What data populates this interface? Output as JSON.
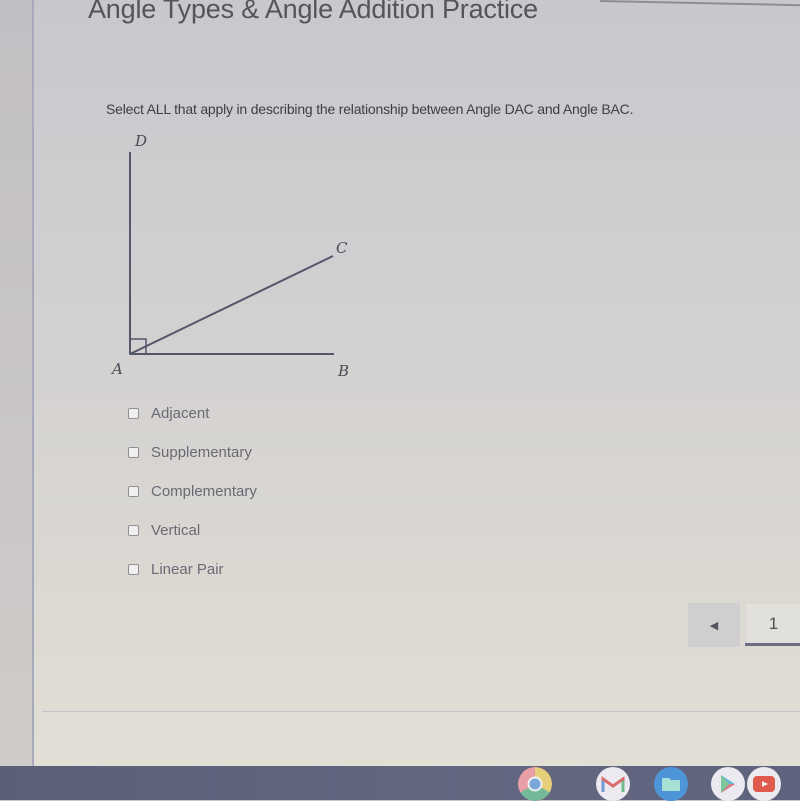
{
  "page": {
    "title": "Angle Types & Angle Addition Practice",
    "prompt": "Select ALL that apply in describing the relationship between Angle DAC and Angle BAC."
  },
  "figure": {
    "labels": {
      "D": "D",
      "C": "C",
      "A": "A",
      "B": "B"
    },
    "right_angle_marker_at": "A"
  },
  "options": [
    {
      "label": "Adjacent",
      "checked": false
    },
    {
      "label": "Supplementary",
      "checked": false
    },
    {
      "label": "Complementary",
      "checked": false
    },
    {
      "label": "Vertical",
      "checked": false
    },
    {
      "label": "Linear Pair",
      "checked": false
    }
  ],
  "pagination": {
    "prev_icon": "◀",
    "current_page": "1"
  },
  "shelf": {
    "apps": [
      {
        "name": "Chrome",
        "icon": "chrome-icon"
      },
      {
        "name": "Gmail",
        "icon": "gmail-icon"
      },
      {
        "name": "Files",
        "icon": "files-icon"
      },
      {
        "name": "Play Store",
        "icon": "play-store-icon"
      },
      {
        "name": "YouTube",
        "icon": "youtube-icon"
      }
    ]
  },
  "colors": {
    "shelf": "#5e627c",
    "pager_underline": "#6d6e86",
    "text": "#3e3e44"
  }
}
